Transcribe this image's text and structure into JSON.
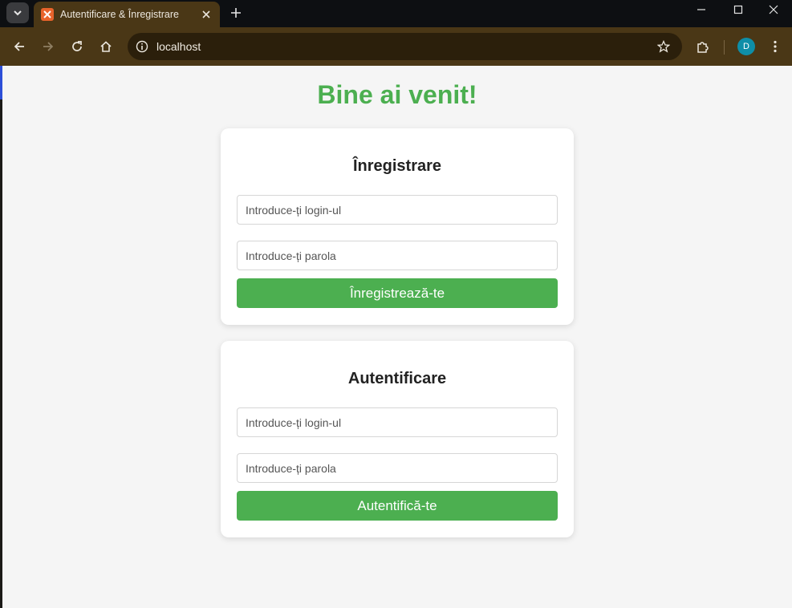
{
  "browser": {
    "tab_title": "Autentificare & Înregistrare",
    "address": "localhost",
    "profile_initial": "D",
    "accent_color": "#4a3716"
  },
  "page": {
    "heading": "Bine ai venit!",
    "accent_color": "#4caf50",
    "register": {
      "title": "Înregistrare",
      "login_placeholder": "Introduce-ți login-ul",
      "password_placeholder": "Introduce-ți parola",
      "button_label": "Înregistrează-te"
    },
    "login": {
      "title": "Autentificare",
      "login_placeholder": "Introduce-ți login-ul",
      "password_placeholder": "Introduce-ți parola",
      "button_label": "Autentifică-te"
    }
  }
}
